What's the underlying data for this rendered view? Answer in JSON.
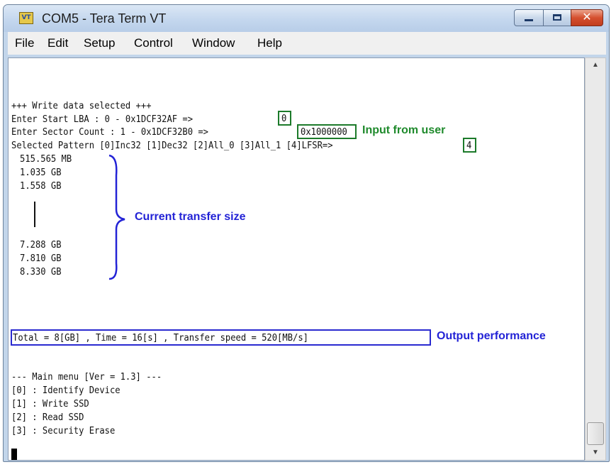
{
  "window": {
    "icon_text": "VT",
    "title": "COM5 - Tera Term VT",
    "buttons": {
      "minimize": "minimize",
      "maximize": "maximize",
      "close": "✕"
    }
  },
  "menu": [
    "File",
    "Edit",
    "Setup",
    "Control",
    "Window",
    "Help"
  ],
  "terminal": {
    "lines": [
      "+++ Write data selected +++",
      "Enter Start LBA : 0 - 0x1DCF32AF =>",
      "Enter Sector Count : 1 - 0x1DCF32B0 =>",
      "Selected Pattern [0]Inc32 [1]Dec32 [2]All_0 [3]All_1 [4]LFSR=>",
      "515.565 MB",
      "1.035 GB",
      "1.558 GB",
      "7.288 GB",
      "7.810 GB",
      "8.330 GB",
      "Total = 8[GB] , Time = 16[s] , Transfer speed = 520[MB/s]",
      "--- Main menu [Ver = 1.3] ---",
      "[0] : Identify Device",
      "[1] : Write SSD",
      "[2] : Read SSD",
      "[3] : Security Erase"
    ],
    "inputs": {
      "start_lba": "0",
      "sector_count": "0x1000000",
      "pattern": "4"
    }
  },
  "annotations": {
    "input_from_user": "Input from user",
    "current_transfer_size": "Current transfer size",
    "output_performance": "Output performance"
  },
  "colors": {
    "annotation_green": "#1f8a2c",
    "annotation_blue": "#2323d6"
  }
}
